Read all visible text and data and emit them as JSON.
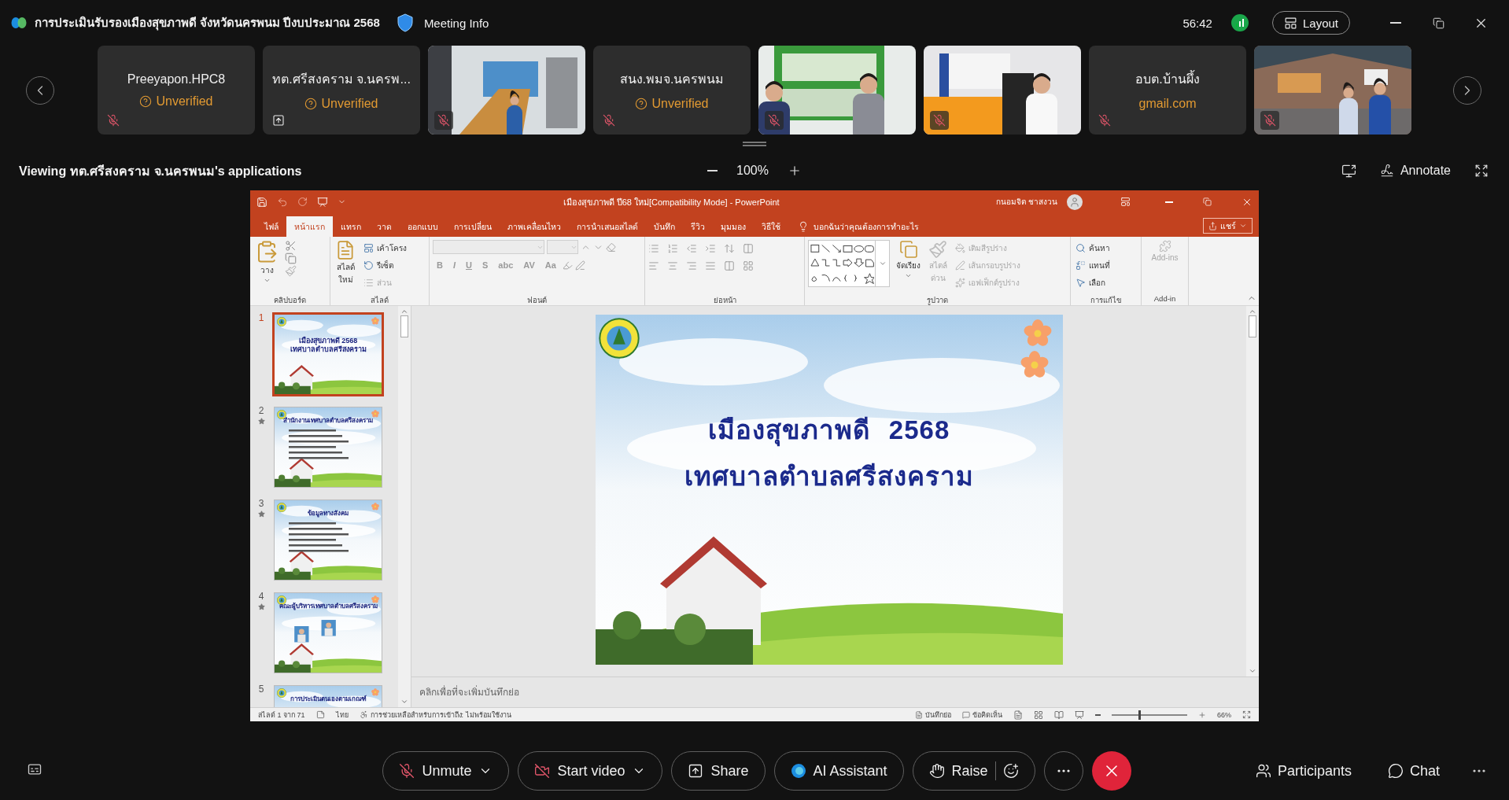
{
  "meeting": {
    "title": "การประเมินรับรองเมืองสุขภาพดี จังหวัดนครพนม ปีงบประมาณ 2568",
    "info_label": "Meeting Info",
    "timer": "56:42",
    "layout_label": "Layout"
  },
  "participants": [
    {
      "kind": "name",
      "name": "Preeyapon.HPC8",
      "status": "Unverified",
      "status_icon": true,
      "muted": true,
      "sharing": false
    },
    {
      "kind": "name",
      "name": "ทต.ศรีสงคราม จ.นครพ...",
      "status": "Unverified",
      "status_icon": true,
      "muted": false,
      "sharing": true
    },
    {
      "kind": "video",
      "muted": true,
      "sharing": false
    },
    {
      "kind": "name",
      "name": "สนง.พมจ.นครพนม",
      "status": "Unverified",
      "status_icon": true,
      "muted": true,
      "sharing": false
    },
    {
      "kind": "video",
      "muted": true,
      "sharing": false
    },
    {
      "kind": "video",
      "muted": true,
      "sharing": false
    },
    {
      "kind": "name",
      "name": "อบต.บ้านผึ้ง",
      "status": "gmail.com",
      "status_icon": false,
      "muted": true,
      "sharing": false
    },
    {
      "kind": "video",
      "muted": true,
      "sharing": false
    }
  ],
  "viewing": {
    "label": "Viewing ทต.ศรีสงคราม จ.นครพนม's applications",
    "zoom": "100%",
    "annotate": "Annotate"
  },
  "powerpoint": {
    "title": "เมืองสุขภาพดี ปี68 ใหม่[Compatibility Mode]  -  PowerPoint",
    "user": "กนอมจิต ชาสงวน",
    "tabs": [
      {
        "label": "ไฟล์",
        "selected": false
      },
      {
        "label": "หน้าแรก",
        "selected": true
      },
      {
        "label": "แทรก",
        "selected": false
      },
      {
        "label": "วาด",
        "selected": false
      },
      {
        "label": "ออกแบบ",
        "selected": false
      },
      {
        "label": "การเปลี่ยน",
        "selected": false
      },
      {
        "label": "ภาพเคลื่อนไหว",
        "selected": false
      },
      {
        "label": "การนำเสนอสไลด์",
        "selected": false
      },
      {
        "label": "บันทึก",
        "selected": false
      },
      {
        "label": "รีวิว",
        "selected": false
      },
      {
        "label": "มุมมอง",
        "selected": false
      },
      {
        "label": "วิธีใช้",
        "selected": false
      }
    ],
    "tell_me": "บอกฉันว่าคุณต้องการทำอะไร",
    "share": "แชร์",
    "ribbon": {
      "clipboard": {
        "label": "คลิปบอร์ด",
        "paste": "วาง"
      },
      "slides": {
        "label": "สไลด์",
        "new_slide": [
          "สไลด์",
          "ใหม่"
        ],
        "items": [
          {
            "label": "เค้าโครง",
            "disabled": false
          },
          {
            "label": "รีเซ็ต",
            "disabled": false
          },
          {
            "label": "ส่วน",
            "disabled": true
          }
        ]
      },
      "font": {
        "label": "ฟอนต์",
        "disabled": true,
        "buttons": [
          "B",
          "I",
          "U",
          "S",
          "abc",
          "AV",
          "Aa"
        ]
      },
      "paragraph": {
        "label": "ย่อหน้า"
      },
      "drawing": {
        "label": "รูปวาด",
        "arrange": "จัดเรียง",
        "quick_styles": {
          "lines": [
            "สไตล์",
            "ด่วน"
          ],
          "disabled": true
        },
        "items": [
          {
            "label": "เติมสีรูปร่าง",
            "disabled": true
          },
          {
            "label": "เส้นกรอบรูปร่าง",
            "disabled": true
          },
          {
            "label": "เอฟเฟ็กต์รูปร่าง",
            "disabled": true
          }
        ]
      },
      "editing": {
        "label": "การแก้ไข",
        "items": [
          {
            "label": "ค้นหา",
            "kind": "find"
          },
          {
            "label": "แทนที่",
            "kind": "replace"
          },
          {
            "label": "เลือก",
            "kind": "select"
          }
        ]
      },
      "addins": {
        "label": "Add-in",
        "button": "Add-ins",
        "disabled": true
      }
    },
    "thumbnails": [
      {
        "number": "1",
        "kind": "title",
        "title_lines": [
          "เมืองสุขภาพดี 2568",
          "เทศบาลตำบลศรีสงคราม"
        ],
        "selected": true,
        "animated": false
      },
      {
        "number": "2",
        "kind": "content",
        "title_lines": [
          "สำนักงานเทศบาลตำบลศรีสงคราม"
        ],
        "selected": false,
        "animated": true
      },
      {
        "number": "3",
        "kind": "content",
        "title_lines": [
          "ข้อมูลทางสังคม"
        ],
        "selected": false,
        "animated": true
      },
      {
        "number": "4",
        "kind": "people",
        "title_lines": [
          "คณะผู้บริหารเทศบาลตำบลศรีสงคราม"
        ],
        "selected": false,
        "animated": true
      },
      {
        "number": "5",
        "kind": "content",
        "title_lines": [
          "การประเมินตนเองตามเกณฑ์"
        ],
        "selected": false,
        "animated": false
      }
    ],
    "slide": {
      "title_lines": [
        "เมืองสุขภาพดี 2568",
        "เทศบาลตำบลศรีสงคราม"
      ]
    },
    "notes": {
      "placeholder": "คลิกเพื่อที่จะเพิ่มบันทึกย่อ"
    },
    "status": {
      "slide": "สไลด์ 1 จาก 71",
      "language": "ไทย",
      "accessibility": "การช่วยเหลือสำหรับการเข้าถึง: ไม่พร้อมใช้งาน",
      "notes": "บันทึกย่อ",
      "comments": "ข้อคิดเห็น",
      "zoom": "66%",
      "zoom_slider": {
        "level": 0.35
      }
    }
  },
  "toolbar": {
    "buttons": [
      {
        "label": "Unmute",
        "kind": "mic"
      },
      {
        "label": "Start video",
        "kind": "video"
      },
      {
        "label": "Share",
        "kind": "share"
      },
      {
        "label": "AI Assistant",
        "kind": "ai"
      },
      {
        "label": "Raise",
        "kind": "raise"
      }
    ],
    "participants": "Participants",
    "chat": "Chat"
  }
}
